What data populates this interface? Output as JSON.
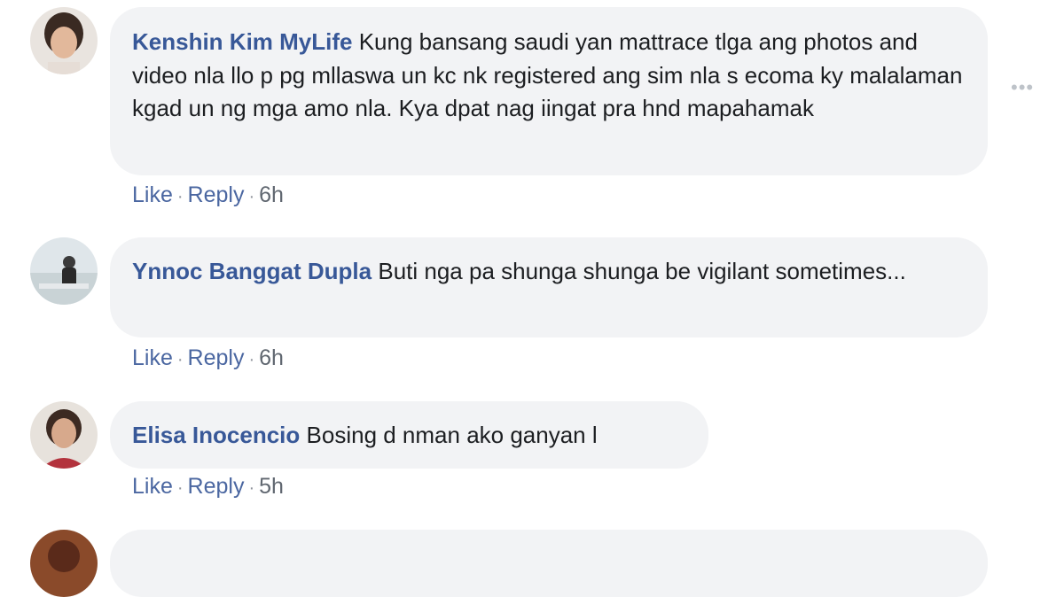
{
  "comments": [
    {
      "author": "Kenshin Kim MyLife",
      "text": "Kung bansang saudi yan mattrace tlga ang photos and video nla llo p pg mllaswa un kc nk registered ang sim nla s ecoma ky malalaman kgad un ng mga amo nla. Kya dpat nag iingat pra hnd mapahamak",
      "like": "Like",
      "reply": "Reply",
      "time": "6h"
    },
    {
      "author": "Ynnoc Banggat Dupla",
      "text": "Buti nga pa shunga shunga be vigilant sometimes...",
      "like": "Like",
      "reply": "Reply",
      "time": "6h"
    },
    {
      "author": "Elisa Inocencio",
      "text": "Bosing d nman ako ganyan l",
      "like": "Like",
      "reply": "Reply",
      "time": "5h"
    }
  ],
  "more_options_icon": "more-horizontal-icon",
  "colors": {
    "author_name": "#385898",
    "bubble_bg": "#f2f3f5",
    "action_link": "#4b67a1",
    "body_text": "#1c1e21"
  }
}
